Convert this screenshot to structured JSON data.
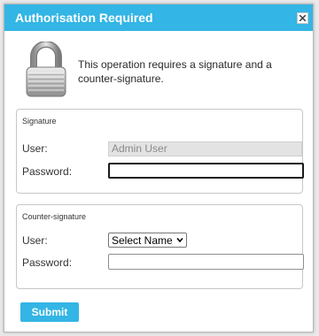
{
  "dialog": {
    "title": "Authorisation Required",
    "message": "This operation requires a signature and a counter-signature.",
    "close_icon": "close-icon",
    "lock_icon": "padlock-icon",
    "colors": {
      "title_bar": "#33b5e5",
      "submit": "#33b5e5"
    }
  },
  "signature": {
    "legend": "Signature",
    "user_label": "User:",
    "user_value": "Admin User",
    "password_label": "Password:",
    "password_value": ""
  },
  "counter_signature": {
    "legend": "Counter-signature",
    "user_label": "User:",
    "user_selected": "Select Name",
    "password_label": "Password:",
    "password_value": ""
  },
  "submit_label": "Submit"
}
